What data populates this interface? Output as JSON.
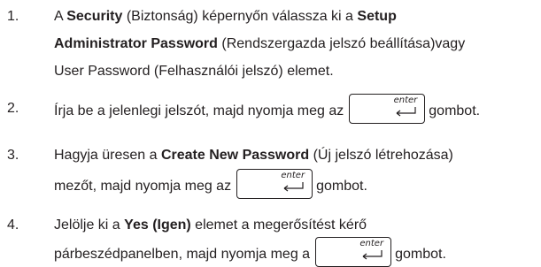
{
  "steps": [
    {
      "number": "1.",
      "lines": [
        {
          "t1": "A ",
          "b1": "Security",
          "t2": " (Biztonság) képernyőn válassza ki a ",
          "b2": "Setup"
        },
        {
          "b1": "Administrator Password",
          "t1": " (Rendszergazda jelszó beállítása)vagy"
        },
        {
          "t1": "User Password (Felhasználói jelszó) elemet."
        }
      ]
    },
    {
      "number": "2.",
      "lines": [
        {
          "t1": "Írja be a jelenlegi jelszót, majd nyomja meg az",
          "t2": "gombot."
        }
      ]
    },
    {
      "number": "3.",
      "lines": [
        {
          "t1": "Hagyja üresen a ",
          "b1": "Create New Password",
          "t2": " (Új jelszó létrehozása)"
        },
        {
          "t1": "mezőt, majd nyomja meg az",
          "t2": "gombot."
        }
      ]
    },
    {
      "number": "4.",
      "lines": [
        {
          "t1": "Jelölje ki a ",
          "b1": "Yes (Igen)",
          "t2": " elemet a megerősítést kérő"
        },
        {
          "t1": "párbeszédpanelben, majd nyomja meg a",
          "t2": "gombot."
        }
      ]
    }
  ],
  "enter_key": {
    "label": "enter",
    "icon": "enter-arrow-icon"
  }
}
